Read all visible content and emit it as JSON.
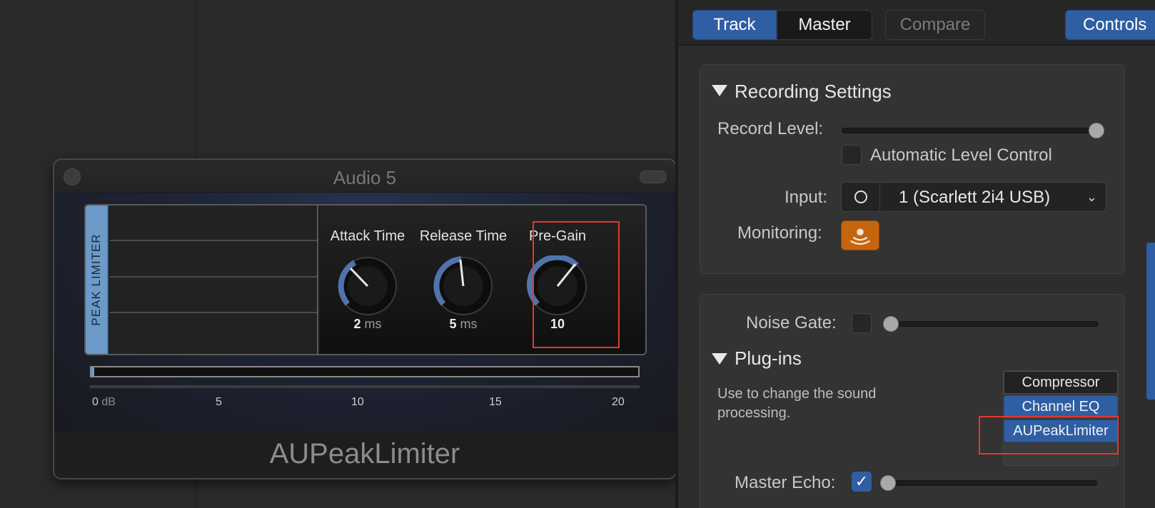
{
  "plugin_window": {
    "title": "Audio 5",
    "panel_label": "PEAK LIMITER",
    "plugin_name": "AUPeakLimiter",
    "knobs": [
      {
        "label": "Attack Time",
        "value": "2",
        "unit": "ms"
      },
      {
        "label": "Release Time",
        "value": "5",
        "unit": "ms"
      },
      {
        "label": "Pre-Gain",
        "value": "10",
        "unit": ""
      }
    ],
    "meter": {
      "scale": [
        "0",
        "5",
        "10",
        "15",
        "20"
      ],
      "scale_unit": "dB"
    }
  },
  "toolbar": {
    "track": "Track",
    "master": "Master",
    "compare": "Compare",
    "controls": "Controls"
  },
  "recording": {
    "title": "Recording Settings",
    "record_level_label": "Record Level:",
    "record_level": 1.0,
    "auto_level_label": "Automatic Level Control",
    "auto_level_checked": false,
    "input_label": "Input:",
    "input_value": "1  (Scarlett 2i4 USB)",
    "monitoring_label": "Monitoring:"
  },
  "plugins_section": {
    "noise_gate_label": "Noise Gate:",
    "title": "Plug-ins",
    "help_text": "Use to change the sound processing.",
    "plugins": [
      "Compressor",
      "Channel EQ",
      "AUPeakLimiter"
    ],
    "master_echo_label": "Master Echo:",
    "master_echo_checked": true
  },
  "colors": {
    "accent_blue": "#2f5ea3",
    "monitor_orange": "#c5650e",
    "highlight_red": "#e03a2e"
  }
}
